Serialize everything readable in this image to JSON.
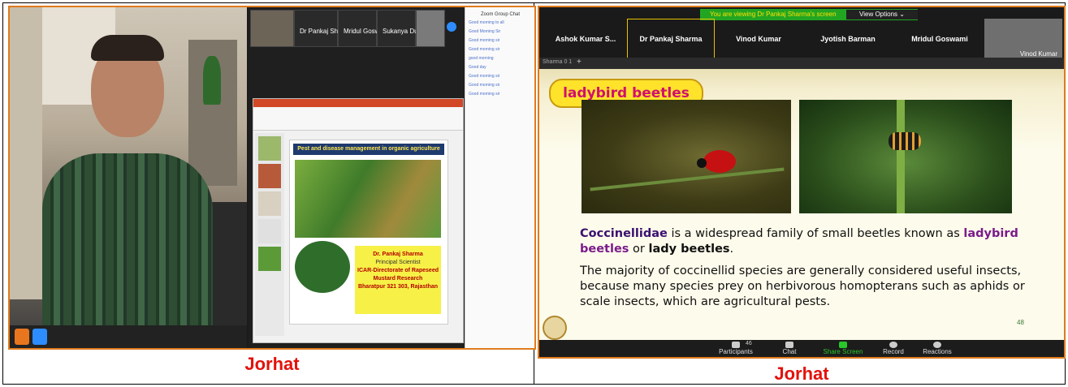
{
  "left": {
    "caption": "Jorhat",
    "zoom_thumbs": [
      "Dr Pankaj Sharma",
      "Mridul Goswami",
      "Sukanya Dutta"
    ],
    "chat_header": "Zoom Group Chat",
    "chat_lines": [
      "Good morning to all",
      "Good Morning Sir",
      "Good morning sir",
      "Good morning sir",
      "good morning",
      "Good day",
      "Good morning sir",
      "Good morning sir",
      "Good morning sir"
    ],
    "slide_title": "Pest and disease management in organic agriculture",
    "slide_author": "Dr. Pankaj Sharma",
    "slide_role": "Principal Scientist",
    "slide_org": "ICAR-Directorate of Rapeseed Mustard Research",
    "slide_place": "Bharatpur 321 303, Rajasthan"
  },
  "right": {
    "caption": "Jorhat",
    "viewing_banner": "You are viewing Dr Pankaj Sharma's screen",
    "view_options": "View Options ⌄",
    "participants": [
      "Ashok Kumar S...",
      "Dr Pankaj Sharma",
      "Vinod Kumar",
      "Jyotish Barman",
      "Mridul Goswami"
    ],
    "self_view_name": "Vinod Kumar",
    "tab_label": "Sharma 0 1",
    "slide_title": "ladybird beetles",
    "para1_term": "Coccinellidae",
    "para1_mid": " is a widespread  family of small beetles known as ",
    "para1_hl": "ladybird beetles",
    "para1_or": " or ",
    "para1_end": "lady beetles",
    "para1_dot": ".",
    "para2": "The majority of coccinellid species are generally considered useful insects, because many species prey on herbivorous  homopterans such as aphids or scale insects, which are agricultural pests.",
    "slide_number": "48",
    "participant_count": "46",
    "toolbar": {
      "participants": "Participants",
      "chat": "Chat",
      "share": "Share Screen",
      "record": "Record",
      "reactions": "Reactions"
    }
  }
}
